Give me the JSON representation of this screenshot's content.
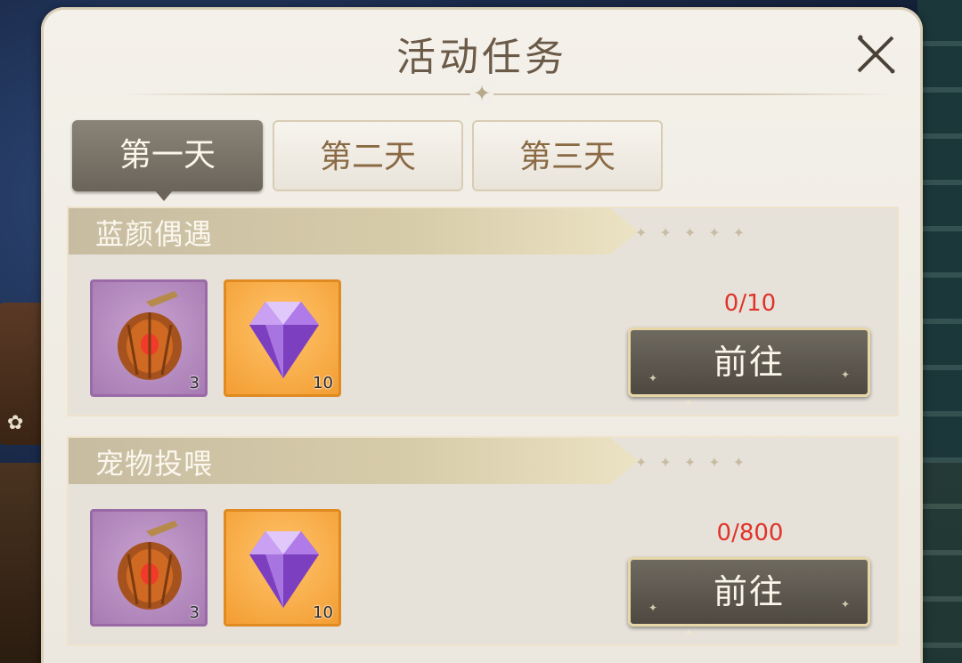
{
  "panel": {
    "title": "活动任务"
  },
  "tabs": [
    {
      "label": "第一天",
      "active": true
    },
    {
      "label": "第二天",
      "active": false
    },
    {
      "label": "第三天",
      "active": false
    }
  ],
  "tasks": [
    {
      "title": "蓝颜偶遇",
      "progress": "0/10",
      "rewards": [
        {
          "icon": "lantern-fruit-icon",
          "count": "3",
          "rarity_color": "#a67bb3"
        },
        {
          "icon": "purple-diamond-icon",
          "count": "10",
          "rarity_color": "#f39d32"
        }
      ],
      "button": "前往"
    },
    {
      "title": "宠物投喂",
      "progress": "0/800",
      "rewards": [
        {
          "icon": "lantern-fruit-icon",
          "count": "3",
          "rarity_color": "#a67bb3"
        },
        {
          "icon": "purple-diamond-icon",
          "count": "10",
          "rarity_color": "#f39d32"
        }
      ],
      "button": "前往"
    }
  ],
  "colors": {
    "progress_text": "#e0332a",
    "active_tab": "#6a645a",
    "panel_bg": "#f4f1ea"
  }
}
